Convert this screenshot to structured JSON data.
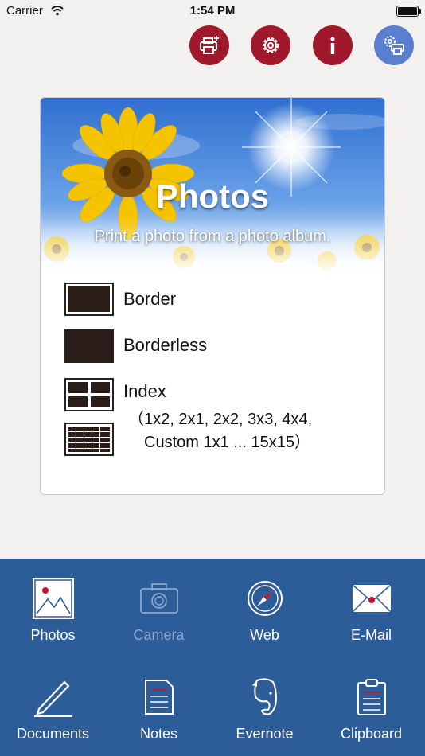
{
  "status_bar": {
    "carrier": "Carrier",
    "time": "1:54 PM"
  },
  "toolbar": {
    "buttons": [
      {
        "name": "add-printer",
        "icon": "printer-plus-icon",
        "color": "#a0182b"
      },
      {
        "name": "settings",
        "icon": "gear-icon",
        "color": "#a0182b"
      },
      {
        "name": "info",
        "icon": "info-icon",
        "color": "#a0182b"
      },
      {
        "name": "printer-settings",
        "icon": "printer-gear-icon",
        "color": "#5b7fd0"
      }
    ]
  },
  "card": {
    "title": "Photos",
    "subtitle": "Print a photo from a photo album.",
    "options": [
      {
        "label": "Border",
        "icon": "border-layout-icon"
      },
      {
        "label": "Borderless",
        "icon": "borderless-layout-icon"
      },
      {
        "label": "Index",
        "icon": "index-layout-icon"
      }
    ],
    "index_detail_line1": "（1x2, 2x1, 2x2, 3x3, 4x4,",
    "index_detail_line2": "Custom 1x1 ... 15x15）"
  },
  "tabbar": {
    "background": "#2d5d99",
    "tabs": [
      {
        "label": "Photos",
        "icon": "photo-icon",
        "enabled": true
      },
      {
        "label": "Camera",
        "icon": "camera-icon",
        "enabled": false
      },
      {
        "label": "Web",
        "icon": "compass-icon",
        "enabled": true
      },
      {
        "label": "E-Mail",
        "icon": "envelope-icon",
        "enabled": true
      },
      {
        "label": "Documents",
        "icon": "pen-icon",
        "enabled": true
      },
      {
        "label": "Notes",
        "icon": "note-icon",
        "enabled": true
      },
      {
        "label": "Evernote",
        "icon": "evernote-icon",
        "enabled": true
      },
      {
        "label": "Clipboard",
        "icon": "clipboard-icon",
        "enabled": true
      }
    ]
  }
}
